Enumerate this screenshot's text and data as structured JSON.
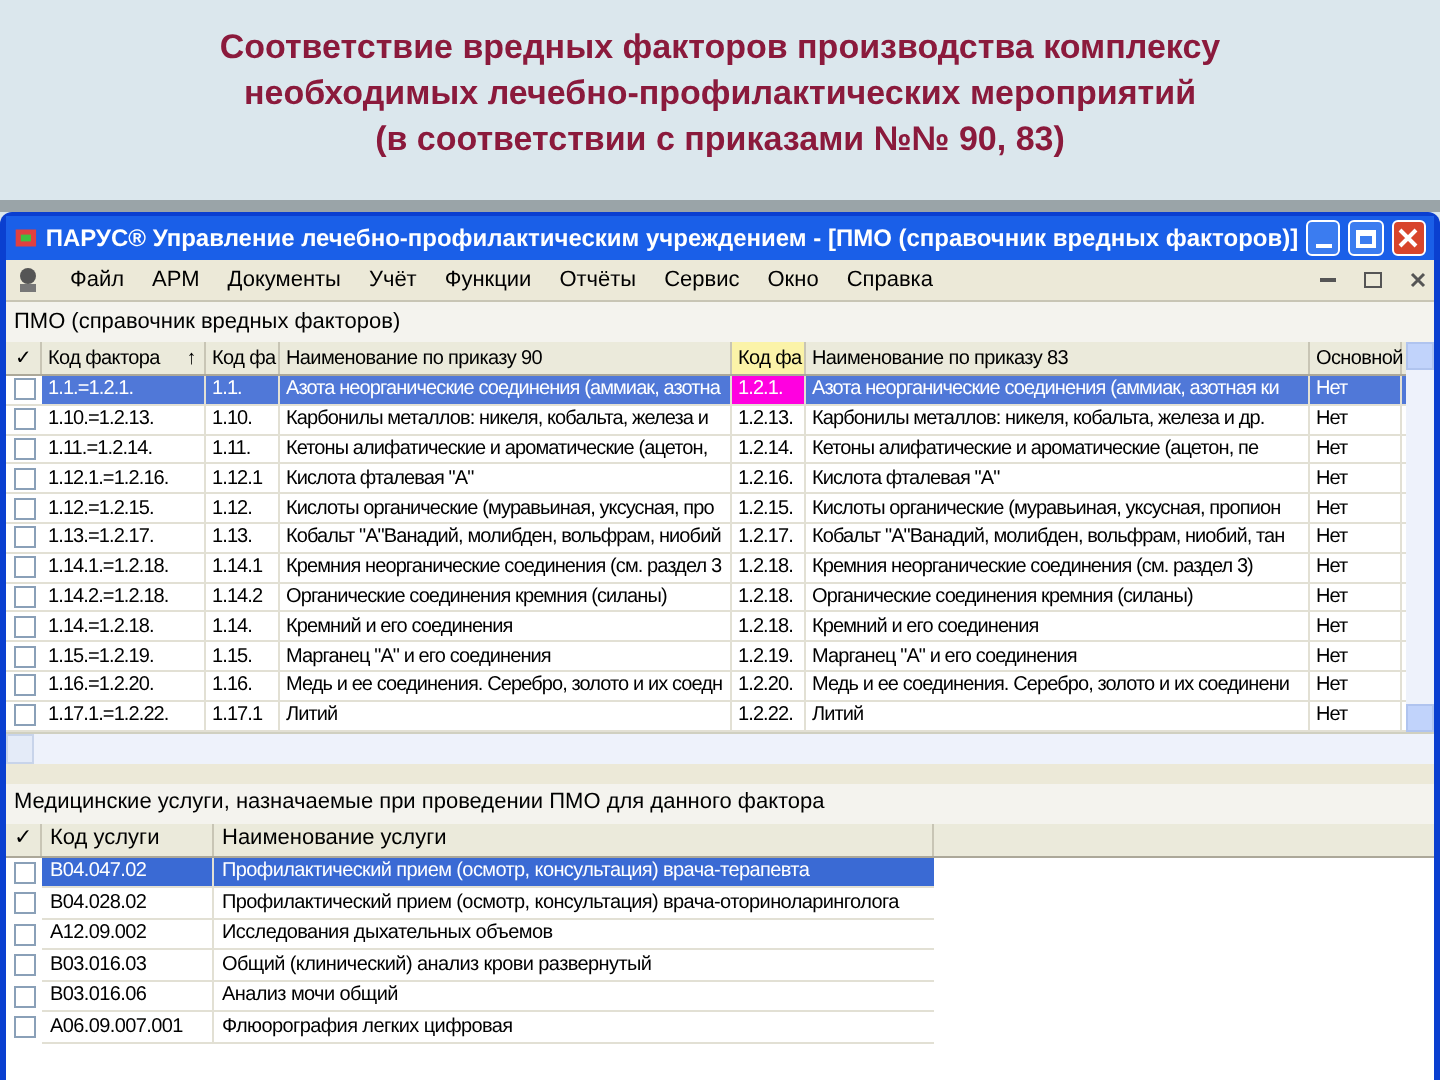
{
  "slide_title": [
    "Соответствие вредных факторов производства комплексу",
    "необходимых лечебно-профилактических мероприятий",
    "(в соответствии с приказами №№ 90, 83)"
  ],
  "window": {
    "title": "ПАРУС® Управление лечебно-профилактическим учреждением - [ПМО (справочник вредных факторов)]"
  },
  "menu": [
    "Файл",
    "АРМ",
    "Документы",
    "Учёт",
    "Функции",
    "Отчёты",
    "Сервис",
    "Окно",
    "Справка"
  ],
  "factors": {
    "title": "ПМО (справочник вредных факторов)",
    "check_header": "✓",
    "sort_indicator": "↑",
    "columns": [
      "Код фактора",
      "Код фа",
      "Наименование по приказу 90",
      "Код фа",
      "Наименование по приказу 83",
      "Основной"
    ],
    "rows": [
      {
        "selected": true,
        "checked": false,
        "focused": true,
        "cells": [
          "1.1.=1.2.1.",
          "1.1.",
          "Азота неорганические соединения (аммиак, азотна",
          "1.2.1.",
          "Азота неорганические соединения (аммиак, азотная ки",
          "Нет"
        ]
      },
      {
        "selected": false,
        "checked": false,
        "focused": false,
        "cells": [
          "1.10.=1.2.13.",
          "1.10.",
          "Карбонилы металлов: никеля, кобальта, железа и",
          "1.2.13.",
          "Карбонилы металлов: никеля, кобальта, железа и др.",
          "Нет"
        ]
      },
      {
        "selected": false,
        "checked": false,
        "focused": false,
        "cells": [
          "1.11.=1.2.14.",
          "1.11.",
          "Кетоны алифатические и ароматические (ацетон,",
          "1.2.14.",
          "Кетоны алифатические и ароматические (ацетон, пе",
          "Нет"
        ]
      },
      {
        "selected": false,
        "checked": false,
        "focused": false,
        "cells": [
          "1.12.1.=1.2.16.",
          "1.12.1",
          "Кислота фталевая \"А\"",
          "1.2.16.",
          "Кислота фталевая \"А\"",
          "Нет"
        ]
      },
      {
        "selected": false,
        "checked": false,
        "focused": false,
        "cells": [
          "1.12.=1.2.15.",
          "1.12.",
          "Кислоты органические (муравьиная, уксусная, про",
          "1.2.15.",
          "Кислоты органические (муравьиная, уксусная, пропион",
          "Нет"
        ]
      },
      {
        "selected": false,
        "checked": false,
        "focused": false,
        "cells": [
          "1.13.=1.2.17.",
          "1.13.",
          "Кобальт \"А\"Ванадий, молибден, вольфрам, ниобий",
          "1.2.17.",
          "Кобальт \"А\"Ванадий, молибден, вольфрам, ниобий, тан",
          "Нет"
        ]
      },
      {
        "selected": false,
        "checked": false,
        "focused": false,
        "cells": [
          "1.14.1.=1.2.18.",
          "1.14.1",
          "Кремния неорганические соединения (см. раздел 3",
          "1.2.18.",
          "Кремния неорганические соединения (см. раздел 3)",
          "Нет"
        ]
      },
      {
        "selected": false,
        "checked": false,
        "focused": false,
        "cells": [
          "1.14.2.=1.2.18.",
          "1.14.2",
          "Органические соединения кремния (силаны)",
          "1.2.18.",
          "Органические соединения кремния (силаны)",
          "Нет"
        ]
      },
      {
        "selected": false,
        "checked": false,
        "focused": false,
        "cells": [
          "1.14.=1.2.18.",
          "1.14.",
          "Кремний и его соединения",
          "1.2.18.",
          "Кремний и его соединения",
          "Нет"
        ]
      },
      {
        "selected": false,
        "checked": false,
        "focused": false,
        "cells": [
          "1.15.=1.2.19.",
          "1.15.",
          "Марганец \"А\" и его соединения",
          "1.2.19.",
          "Марганец \"А\" и его соединения",
          "Нет"
        ]
      },
      {
        "selected": false,
        "checked": false,
        "focused": false,
        "cells": [
          "1.16.=1.2.20.",
          "1.16.",
          "Медь и ее соединения. Серебро, золото и их соедн",
          "1.2.20.",
          "Медь и ее соединения. Серебро, золото и их соединени",
          "Нет"
        ]
      },
      {
        "selected": false,
        "checked": false,
        "focused": false,
        "cells": [
          "1.17.1.=1.2.22.",
          "1.17.1",
          "Литий",
          "1.2.22.",
          "Литий",
          "Нет"
        ]
      }
    ]
  },
  "services": {
    "title": "Медицинские услуги, назначаемые при проведении ПМО для данного фактора",
    "check_header": "✓",
    "columns": [
      "Код услуги",
      "Наименование услуги"
    ],
    "rows": [
      {
        "selected": true,
        "checked": false,
        "cells": [
          "B04.047.02",
          "Профилактический прием (осмотр, консультация) врача-терапевта"
        ]
      },
      {
        "selected": false,
        "checked": false,
        "cells": [
          "B04.028.02",
          "Профилактический прием (осмотр, консультация) врача-оториноларинголога"
        ]
      },
      {
        "selected": false,
        "checked": false,
        "cells": [
          "A12.09.002",
          "Исследования дыхательных объемов"
        ]
      },
      {
        "selected": false,
        "checked": false,
        "cells": [
          "B03.016.03",
          "Общий (клинический) анализ крови развернутый"
        ]
      },
      {
        "selected": false,
        "checked": false,
        "cells": [
          "B03.016.06",
          "Анализ мочи общий"
        ]
      },
      {
        "selected": false,
        "checked": false,
        "cells": [
          "A06.09.007.001",
          "Флюорография легких цифровая"
        ]
      }
    ]
  }
}
